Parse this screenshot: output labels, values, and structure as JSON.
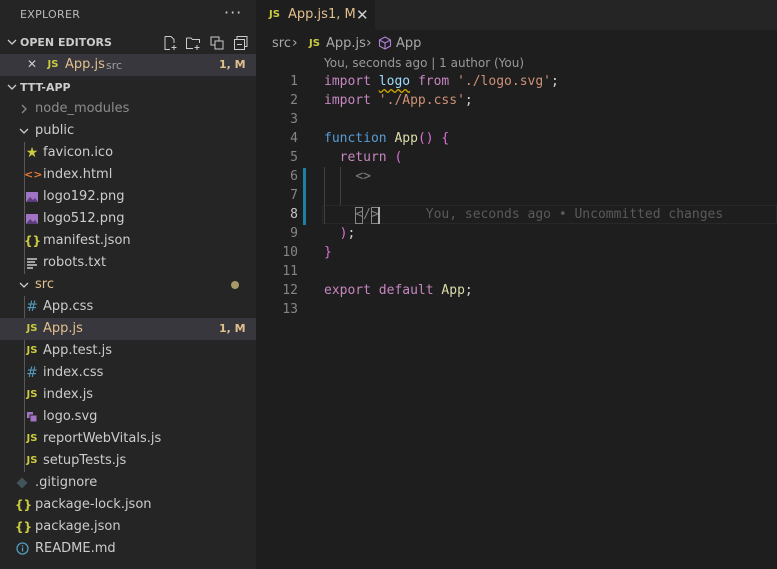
{
  "explorer": {
    "title": "EXPLORER",
    "more": "···",
    "open_editors": {
      "label": "OPEN EDITORS",
      "items": [
        {
          "close": "✕",
          "icon": "JS",
          "name": "App.js",
          "folder": "src",
          "badge": "1, M"
        }
      ]
    },
    "project": {
      "label": "TTT-APP",
      "tree": {
        "node_modules": "node_modules",
        "public": "public",
        "public_files": [
          "favicon.ico",
          "index.html",
          "logo192.png",
          "logo512.png",
          "manifest.json",
          "robots.txt"
        ],
        "src": "src",
        "src_files": [
          "App.css",
          "App.js",
          "App.test.js",
          "index.css",
          "index.js",
          "logo.svg",
          "reportWebVitals.js",
          "setupTests.js"
        ],
        "selected_badge": "1, M",
        "root_files": [
          ".gitignore",
          "package-lock.json",
          "package.json",
          "README.md"
        ]
      }
    }
  },
  "tab": {
    "icon": "JS",
    "name": "App.js",
    "badge": "1, M",
    "close": "✕"
  },
  "breadcrumb": {
    "folder": "src",
    "sep": "›",
    "file_icon": "JS",
    "file": "App.js",
    "symbol": "App"
  },
  "codelens": "You, seconds ago | 1 author (You)",
  "lines": [
    "1",
    "2",
    "3",
    "4",
    "5",
    "6",
    "7",
    "8",
    "9",
    "10",
    "11",
    "12",
    "13"
  ],
  "code": {
    "l1_import": "import",
    "l1_logo": "logo",
    "l1_from": "from",
    "l1_str": "'./logo.svg'",
    "l2_import": "import",
    "l2_str": "'./App.css'",
    "l4_function": "function",
    "l4_name": "App",
    "l5_return": "return",
    "l6": "<>",
    "l8": "</>",
    "l8_blame": "You, seconds ago • Uncommitted changes",
    "l9": ");",
    "l10": "}",
    "l12_export": "export",
    "l12_default": "default",
    "l12_name": "App"
  },
  "colors": {
    "sidebar": "#252526",
    "editor": "#1e1e1e",
    "modified": "#e2c08d",
    "js_icon": "#cbcb41",
    "css_icon": "#519aba",
    "keyword": "#c586c0",
    "string": "#ce9178"
  }
}
